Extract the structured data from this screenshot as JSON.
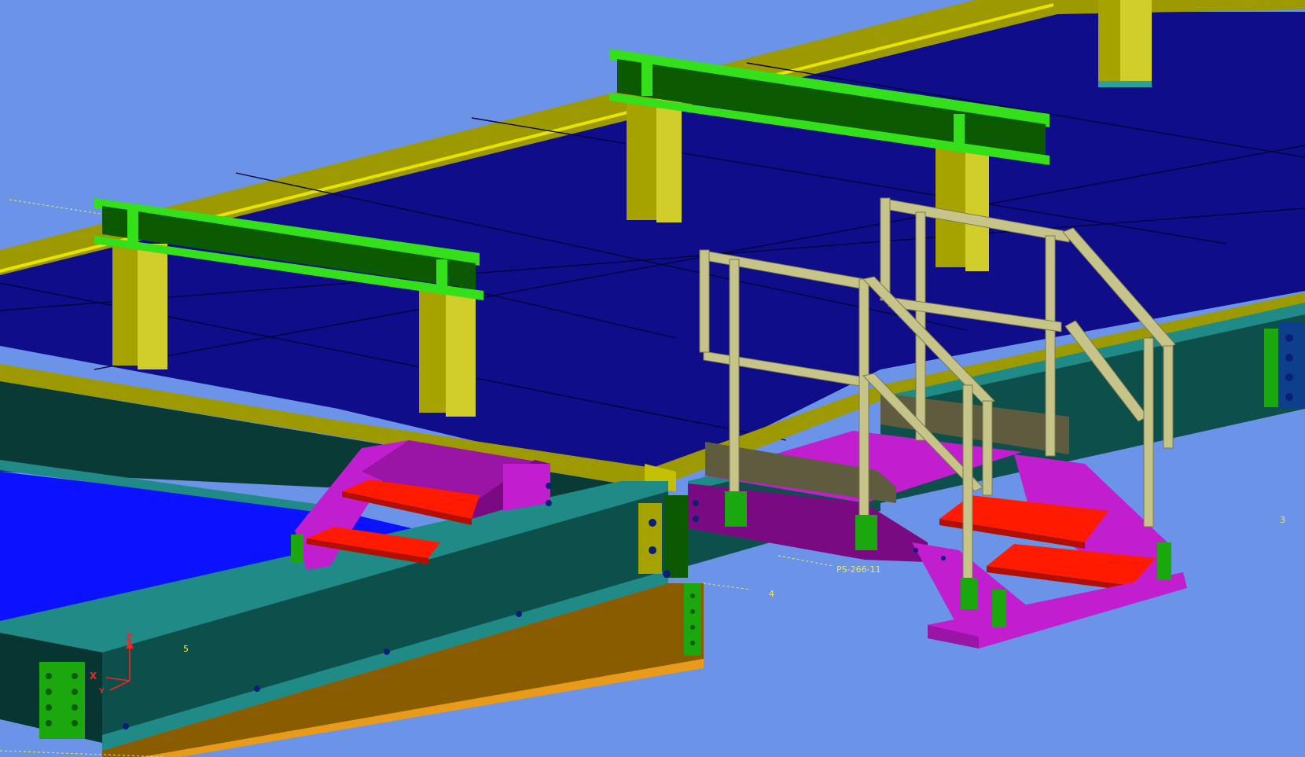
{
  "scene": {
    "background_color": "#6b93e8",
    "colors": {
      "deck": "#0f0d8a",
      "deck_edge_yellow": "#9c9a00",
      "deck_edge_bright": "#d9d600",
      "beam_green": "#0b5a00",
      "beam_green_light": "#33e01a",
      "post_yellow": "#a6a300",
      "post_yellow_light": "#d1ce2b",
      "girder_teal": "#0d4f4a",
      "girder_teal_light": "#1f8a86",
      "girder_teal_dark": "#073532",
      "lower_beam_orange": "#8a5c00",
      "lower_beam_orange_light": "#e89a1a",
      "stair_magenta": "#c11ecf",
      "stair_magenta_dark": "#7a0a82",
      "tread_red": "#ff1a00",
      "railing": "#c7c489",
      "railing_dark": "#7d7a4f",
      "kickplate": "#5e5b3e",
      "plate_green": "#1ba80f",
      "bolt_navy": "#0a1f7a",
      "pool_blue": "#0a12ff",
      "annotation_yellow": "#f2ea4d",
      "axis_red": "#ff2020"
    },
    "annotations": [
      {
        "id": "label-ps",
        "text": "PS-266-11"
      },
      {
        "id": "label-3",
        "text": "3"
      },
      {
        "id": "label-4",
        "text": "4"
      },
      {
        "id": "label-5",
        "text": "5"
      }
    ],
    "axis_triad": {
      "z": "Z",
      "x": "X",
      "y": "Y"
    }
  }
}
